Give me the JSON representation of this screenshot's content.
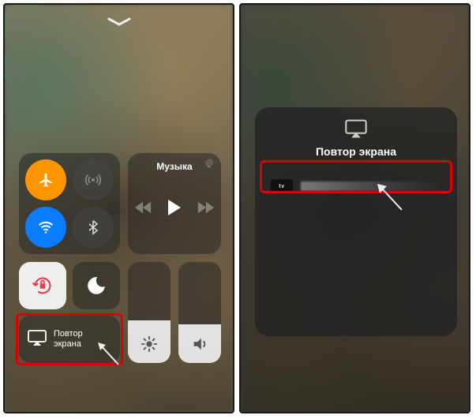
{
  "left": {
    "music_label": "Музыка",
    "mirroring_label": "Повтор\nэкрана",
    "brightness_pct": 42,
    "volume_pct": 38
  },
  "right": {
    "panel_title": "Повтор экрана",
    "device_badge": "tv"
  }
}
